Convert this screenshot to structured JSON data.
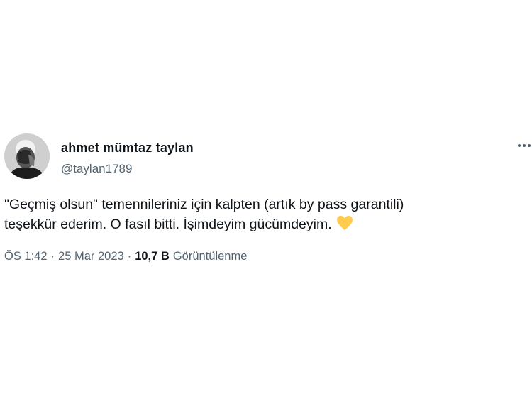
{
  "author": {
    "display_name": "ahmet mümtaz taylan",
    "handle": "@taylan1789"
  },
  "tweet": {
    "line1": "\"Geçmiş olsun\" temennileriniz için kalpten (artık by pass garantili)",
    "line2": "teşekkür ederim. O fasıl bitti. İşimdeyim gücümdeyim.",
    "emoji": "yellow-heart"
  },
  "meta": {
    "time": "ÖS 1:42",
    "separator": "·",
    "date": "25 Mar 2023",
    "views_count": "10,7 B",
    "views_label": "Görüntülenme"
  },
  "colors": {
    "text": "#0f1419",
    "secondary": "#536471",
    "heart": "#ffcc4d"
  }
}
